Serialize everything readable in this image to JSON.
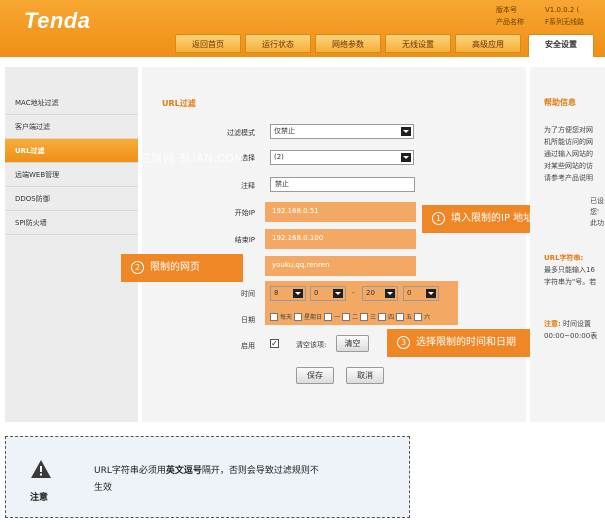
{
  "header": {
    "logo": "Tenda",
    "meta_left": [
      "版本号",
      "产品名称"
    ],
    "meta_right": [
      "V1.0.0.2 (",
      "F系列无线路"
    ],
    "tabs": [
      "返回首页",
      "运行状态",
      "网络参数",
      "无线设置",
      "高级应用",
      "安全设置"
    ]
  },
  "sidebar": {
    "items": [
      {
        "label": "MAC地址过滤"
      },
      {
        "label": "客户端过滤"
      },
      {
        "label": "URL过滤"
      },
      {
        "label": "远端WEB管理"
      },
      {
        "label": "DDOS防御"
      },
      {
        "label": "SPI防火墙"
      }
    ]
  },
  "form": {
    "title": "URL过滤",
    "filter_mode_label": "过滤模式",
    "filter_mode_value": "仅禁止",
    "select_label": "选择",
    "select_value": "(2)",
    "note_label": "注释",
    "note_value": "禁止",
    "start_ip_label": "开始IP",
    "start_ip_value": "192.168.0.51",
    "end_ip_label": "结束IP",
    "end_ip_value": "192.168.0.100",
    "url_value": "youku,qq,renren",
    "time_label": "时间",
    "time_values": [
      "8",
      "0",
      "20",
      "0"
    ],
    "time_sep": [
      "-"
    ],
    "date_label": "日期",
    "days": [
      "每天",
      "星期日",
      "一",
      "二",
      "三",
      "四",
      "五",
      "六"
    ],
    "enable_label": "启用",
    "clear_label": "清空该项:",
    "clear_button": "清空",
    "save_button": "保存",
    "cancel_button": "取消"
  },
  "watermark": "三联网 3LIAN.COM",
  "callouts": {
    "ip": {
      "num": "1",
      "text": "填入限制的IP 地址段"
    },
    "url": {
      "num": "2",
      "text": "限制的网页"
    },
    "time": {
      "num": "3",
      "text": "选择限制的时间和日期"
    }
  },
  "help": {
    "title": "帮助信息",
    "lines": [
      "为了方便您对网",
      "机所能访问的网",
      "通过输入网站的",
      "对某些网站的访",
      "请参考产品说明"
    ],
    "lines2": [
      "已设",
      "您'",
      "此功"
    ],
    "url_title": "URL字符串:",
    "url_lines": [
      "最多只能输入16",
      "字符串为\"号。若"
    ],
    "note_title": "注意:",
    "note_lines": [
      "时间设置",
      "00:00~00:00表"
    ]
  },
  "notice": {
    "icon_label": "注意",
    "text_before": "URL字符串必须用",
    "text_bold": "英文逗号",
    "text_after": "隔开，否则会导致过滤规则不",
    "text_line2": "生效"
  },
  "colors": {
    "accent": "#ef8f16",
    "callout": "#ef8727",
    "highlight": "#f28c2d"
  }
}
